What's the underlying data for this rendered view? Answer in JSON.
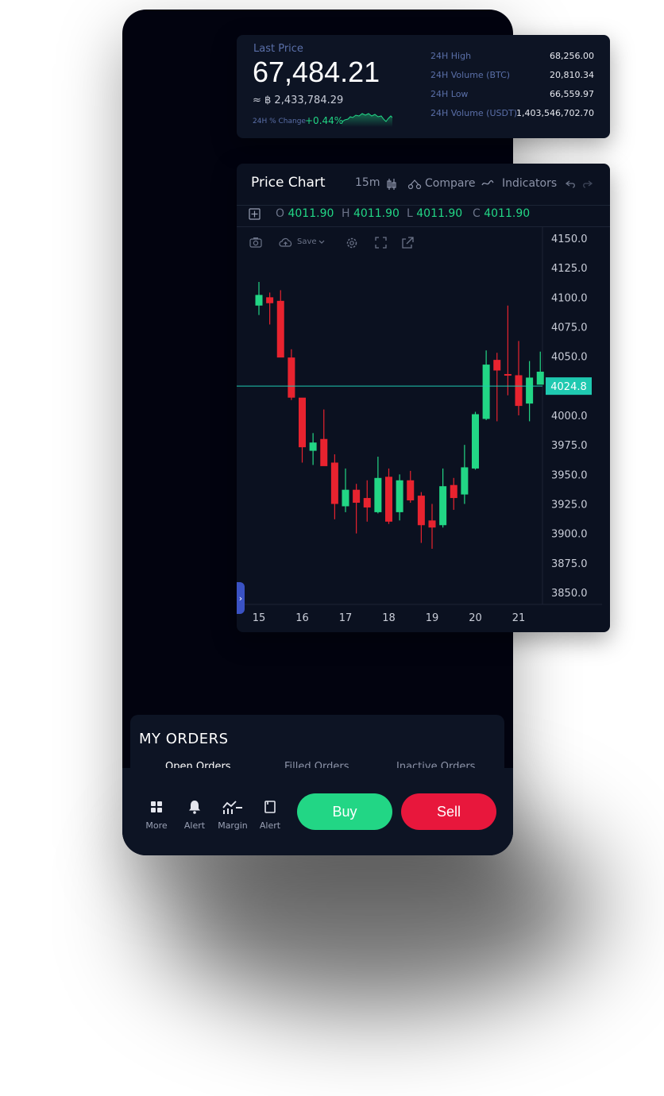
{
  "ticker": {
    "last_price_label": "Last Price",
    "last_price": "67,484.21",
    "approx": "≈ ฿ 2,433,784.29",
    "change_label": "24H % Change",
    "change_value": "+0.44%",
    "stats": [
      {
        "label": "24H High",
        "value": "68,256.00"
      },
      {
        "label": "24H Volume (BTC)",
        "value": "20,810.34"
      },
      {
        "label": "24H Low",
        "value": "66,559.97"
      },
      {
        "label": "24H Volume (USDT)",
        "value": "1,403,546,702.70"
      }
    ]
  },
  "chart_header": {
    "title": "Price Chart",
    "interval": "15m",
    "compare": "Compare",
    "indicators": "Indicators",
    "save": "Save",
    "ohlc": {
      "o_label": "O",
      "o": "4011.90",
      "h_label": "H",
      "h": "4011.90",
      "l_label": "L",
      "l": "4011.90",
      "c_label": "C",
      "c": "4011.90"
    }
  },
  "chart_data": {
    "type": "candlestick",
    "x_ticks": [
      "15",
      "16",
      "17",
      "18",
      "19",
      "20",
      "21"
    ],
    "y_ticks": [
      "4150.0",
      "4125.0",
      "4100.0",
      "4075.0",
      "4050.0",
      "4000.0",
      "3975.0",
      "3950.0",
      "3925.0",
      "3900.0",
      "3875.0",
      "3850.0"
    ],
    "ylim": [
      3850,
      4150
    ],
    "current_price": "4024.8",
    "current_price_value": 4024.8,
    "colors": {
      "up": "#22d685",
      "down": "#e8232f",
      "current": "#1fc9b0"
    },
    "candles": [
      {
        "x": 15.0,
        "o": 4093,
        "h": 4113,
        "l": 4085,
        "c": 4102
      },
      {
        "x": 15.25,
        "o": 4100,
        "h": 4104,
        "l": 4077,
        "c": 4095
      },
      {
        "x": 15.5,
        "o": 4097,
        "h": 4106,
        "l": 4062,
        "c": 4049
      },
      {
        "x": 15.75,
        "o": 4049,
        "h": 4056,
        "l": 4013,
        "c": 4015
      },
      {
        "x": 16.0,
        "o": 4015,
        "h": 4013,
        "l": 3960,
        "c": 3973
      },
      {
        "x": 16.25,
        "o": 3970,
        "h": 3985,
        "l": 3958,
        "c": 3977
      },
      {
        "x": 16.5,
        "o": 3980,
        "h": 4005,
        "l": 3958,
        "c": 3957
      },
      {
        "x": 16.75,
        "o": 3960,
        "h": 3967,
        "l": 3912,
        "c": 3925
      },
      {
        "x": 17.0,
        "o": 3923,
        "h": 3955,
        "l": 3918,
        "c": 3937
      },
      {
        "x": 17.25,
        "o": 3937,
        "h": 3942,
        "l": 3900,
        "c": 3926
      },
      {
        "x": 17.5,
        "o": 3930,
        "h": 3945,
        "l": 3910,
        "c": 3922
      },
      {
        "x": 17.75,
        "o": 3918,
        "h": 3965,
        "l": 3917,
        "c": 3947
      },
      {
        "x": 18.0,
        "o": 3948,
        "h": 3955,
        "l": 3908,
        "c": 3910
      },
      {
        "x": 18.25,
        "o": 3918,
        "h": 3950,
        "l": 3911,
        "c": 3945
      },
      {
        "x": 18.5,
        "o": 3945,
        "h": 3953,
        "l": 3926,
        "c": 3928
      },
      {
        "x": 18.75,
        "o": 3932,
        "h": 3935,
        "l": 3892,
        "c": 3907
      },
      {
        "x": 19.0,
        "o": 3911,
        "h": 3925,
        "l": 3887,
        "c": 3905
      },
      {
        "x": 19.25,
        "o": 3907,
        "h": 3955,
        "l": 3905,
        "c": 3940
      },
      {
        "x": 19.5,
        "o": 3941,
        "h": 3947,
        "l": 3920,
        "c": 3930
      },
      {
        "x": 19.75,
        "o": 3933,
        "h": 3975,
        "l": 3925,
        "c": 3956
      },
      {
        "x": 20.0,
        "o": 3955,
        "h": 4003,
        "l": 3954,
        "c": 4001
      },
      {
        "x": 20.25,
        "o": 3997,
        "h": 4055,
        "l": 3996,
        "c": 4043
      },
      {
        "x": 20.5,
        "o": 4047,
        "h": 4053,
        "l": 3995,
        "c": 4038
      },
      {
        "x": 20.75,
        "o": 4035,
        "h": 4093,
        "l": 4017,
        "c": 4034
      },
      {
        "x": 21.0,
        "o": 4034,
        "h": 4063,
        "l": 4000,
        "c": 4008
      },
      {
        "x": 21.25,
        "o": 4010,
        "h": 4046,
        "l": 3995,
        "c": 4032
      },
      {
        "x": 21.5,
        "o": 4026,
        "h": 4054,
        "l": 4028,
        "c": 4037
      }
    ]
  },
  "orders": {
    "title": "MY ORDERS",
    "tabs": [
      "Open Orders",
      "Filled Orders",
      "Inactive Orders"
    ]
  },
  "nav": {
    "items": [
      {
        "label": "More",
        "icon": "grid-icon"
      },
      {
        "label": "Alert",
        "icon": "bell-icon"
      },
      {
        "label": "Margin",
        "icon": "margin-icon"
      },
      {
        "label": "Alert",
        "icon": "document-icon"
      }
    ],
    "buy": "Buy",
    "sell": "Sell"
  }
}
